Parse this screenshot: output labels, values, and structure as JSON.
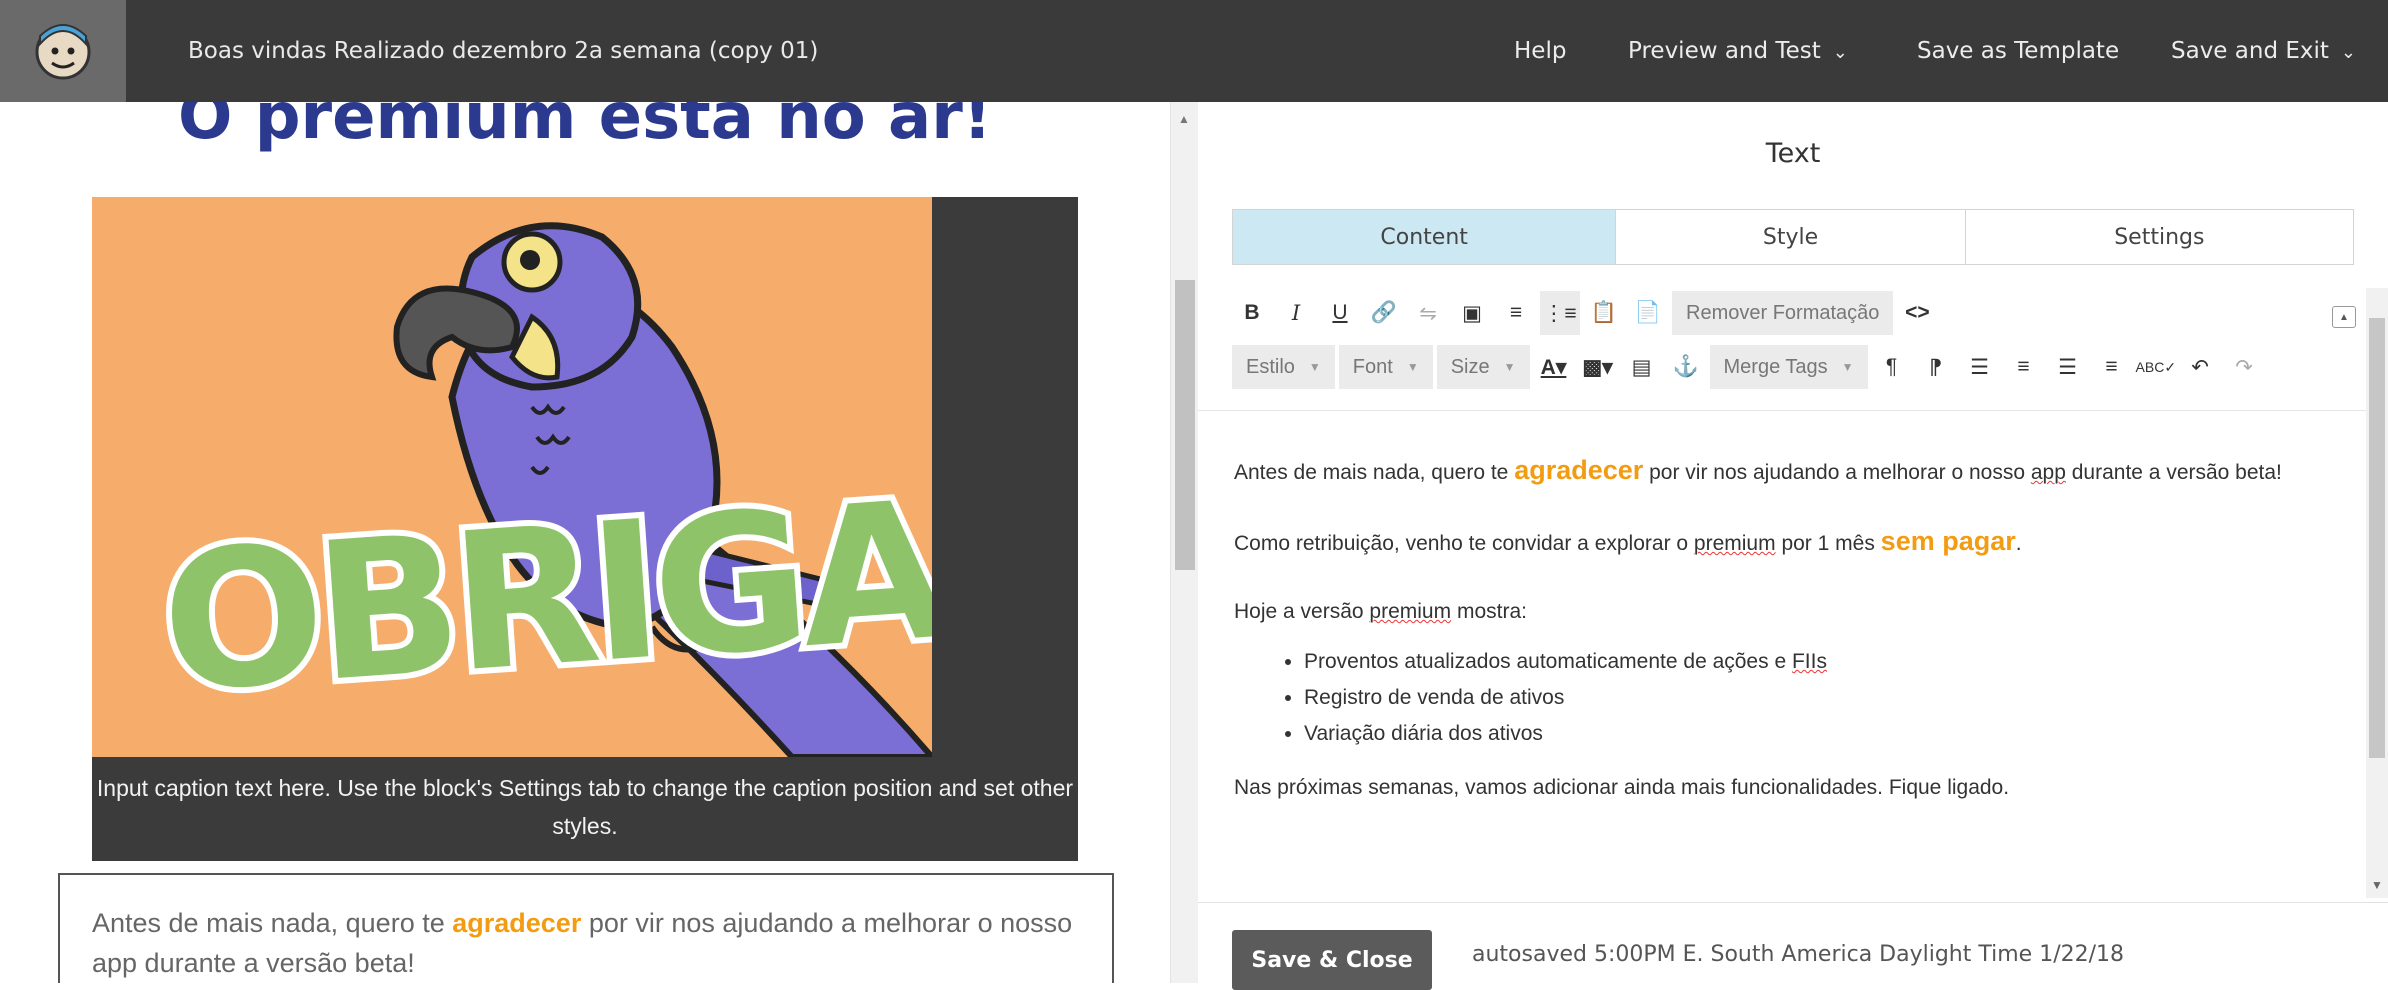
{
  "header": {
    "campaign_title": "Boas vindas Realizado dezembro 2a semana (copy 01)",
    "help": "Help",
    "preview_test": "Preview and Test",
    "save_template": "Save as Template",
    "save_exit": "Save and Exit"
  },
  "preview": {
    "headline": "O premium está no ar!",
    "image_text": "OBRIGADO",
    "caption": "Input caption text here. Use the block's Settings tab to change the caption position and set other styles.",
    "text_before": "Antes de mais nada, quero te",
    "text_highlight": "agradecer",
    "text_after": "por vir nos ajudando a melhorar o nosso app durante a versão beta!"
  },
  "editor": {
    "panel_title": "Text",
    "tabs": [
      "Content",
      "Style",
      "Settings"
    ],
    "toolbar": {
      "remove_format": "Remover Formatação",
      "style": "Estilo",
      "font": "Font",
      "size": "Size",
      "merge_tags": "Merge Tags"
    },
    "body": {
      "p1_before": "Antes de mais nada, quero te",
      "p1_highlight": "agradecer",
      "p1_mid": "por vir nos ajudando a melhorar o nosso",
      "p1_app": "app",
      "p1_after": "durante a versão beta!",
      "p2_before": "Como retribuição, venho te convidar a explorar o",
      "p2_premium": "premium",
      "p2_mid": "por 1 mês",
      "p2_highlight": "sem pagar",
      "p2_end": ".",
      "p3_before": "Hoje a versão",
      "p3_premium": "premium",
      "p3_after": "mostra:",
      "bullet1_before": "Proventos atualizados automaticamente de ações e",
      "bullet1_fiis": "FIIs",
      "bullet2": "Registro de venda de ativos",
      "bullet3": "Variação diária dos ativos",
      "p4": "Nas próximas semanas, vamos adicionar ainda mais funcionalidades. Fique ligado."
    },
    "save_close": "Save & Close",
    "autosave": "autosaved 5:00PM E. South America Daylight Time 1/22/18"
  },
  "colors": {
    "topbar": "#3a3a3a",
    "headline": "#2b3a8f",
    "highlight": "#f39c12",
    "active_tab": "#cce9f3",
    "parrot_body": "#7b6fd6",
    "obrigado_fill": "#8ec36a"
  },
  "icons": [
    "mailchimp-freddie-logo",
    "bold-icon",
    "italic-icon",
    "underline-icon",
    "link-icon",
    "unlink-icon",
    "image-icon",
    "ordered-list-icon",
    "unordered-list-icon",
    "paste-icon",
    "paste-text-icon",
    "source-code-icon"
  ]
}
